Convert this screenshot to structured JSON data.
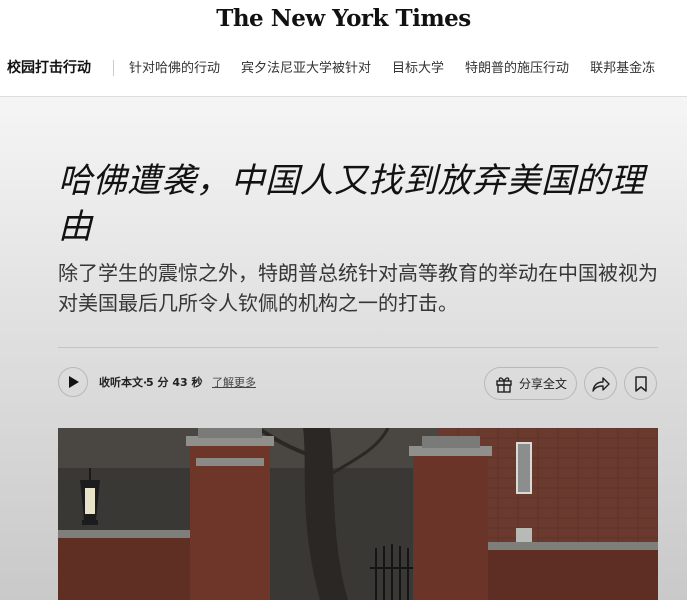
{
  "masthead": {
    "logo_text": "The New York Times"
  },
  "nav": {
    "section_title": "校园打击行动",
    "links": [
      "针对哈佛的行动",
      "宾夕法尼亚大学被针对",
      "目标大学",
      "特朗普的施压行动",
      "联邦基金冻"
    ]
  },
  "article": {
    "headline": "哈佛遭袭，中国人又找到放弃美国的理由",
    "summary": "除了学生的震惊之外，特朗普总统针对高等教育的举动在中国被视为对美国最后几所令人钦佩的机构之一的打击。"
  },
  "toolbar": {
    "listen_label": "收听本文·",
    "listen_duration": "5 分 43 秒",
    "learn_more": "了解更多",
    "share_full_label": "分享全文"
  },
  "icons": {
    "play": "play-icon",
    "gift": "gift-icon",
    "share": "share-arrow-icon",
    "bookmark": "bookmark-icon"
  },
  "photo": {
    "subject": "brick gate with lantern and bare tree"
  }
}
